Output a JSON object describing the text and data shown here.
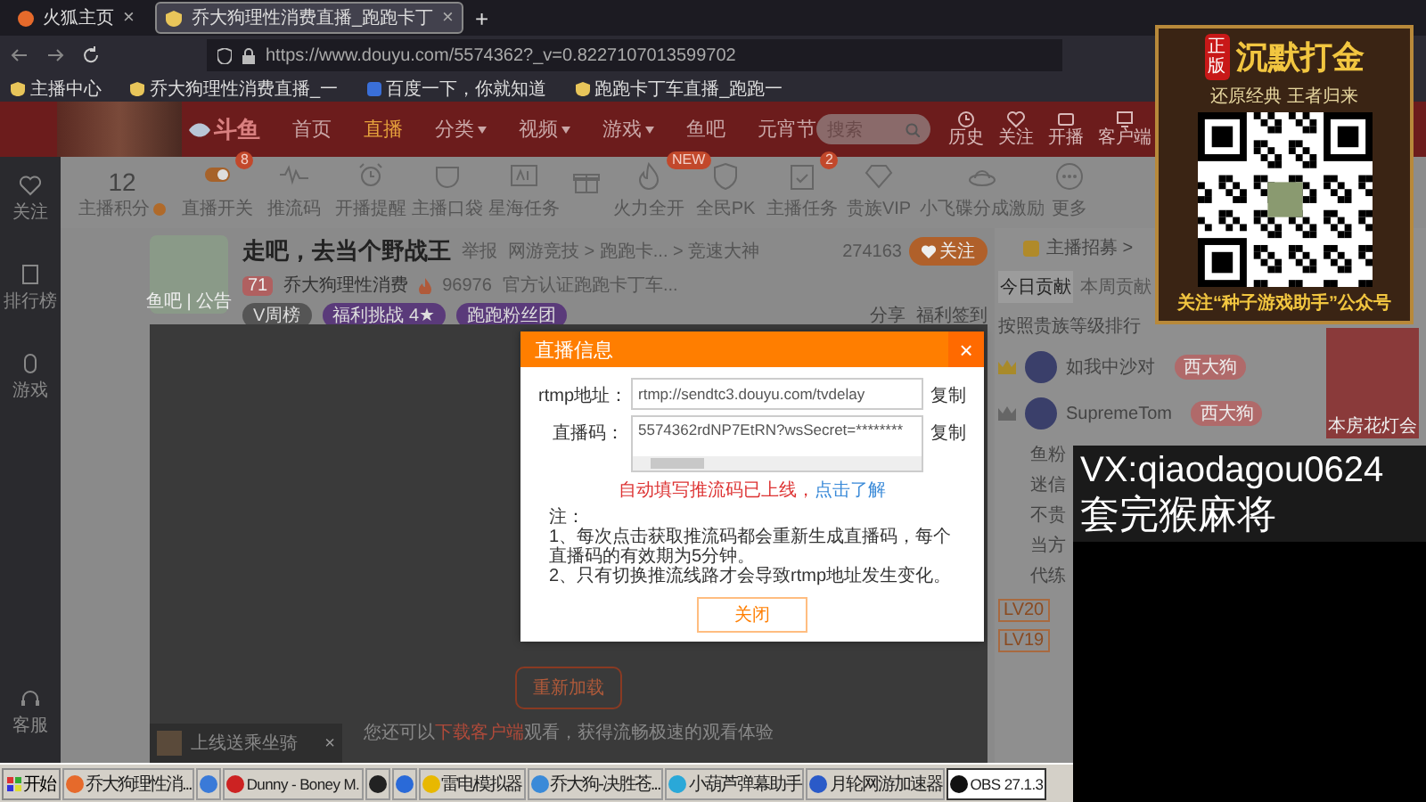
{
  "browser": {
    "tabs": [
      {
        "title": "火狐主页",
        "close": "×",
        "selected": false
      },
      {
        "title": "乔大狗理性消费直播_跑跑卡丁",
        "close": "×",
        "selected": true
      }
    ],
    "new_tab": "+",
    "url": "https://www.douyu.com/5574362?_v=0.8227107013599702",
    "bookmarks": [
      "主播中心",
      "乔大狗理性消费直播_一",
      "百度一下，你就知道",
      "跑跑卡丁车直播_跑跑一"
    ]
  },
  "site_header": {
    "logo": "斗鱼",
    "nav": [
      {
        "label": "首页",
        "selected": false,
        "dropdown": false
      },
      {
        "label": "直播",
        "selected": true,
        "dropdown": false
      },
      {
        "label": "分类",
        "selected": false,
        "dropdown": true
      },
      {
        "label": "视频",
        "selected": false,
        "dropdown": true
      },
      {
        "label": "游戏",
        "selected": false,
        "dropdown": true
      },
      {
        "label": "鱼吧",
        "selected": false,
        "dropdown": false
      },
      {
        "label": "元宵节",
        "selected": false,
        "dropdown": false
      }
    ],
    "search": {
      "placeholder": "搜索"
    },
    "actions": [
      "历史",
      "关注",
      "开播",
      "客户端"
    ]
  },
  "sidebar": [
    "关注",
    "排行榜",
    "游戏",
    "客服"
  ],
  "toolbar": {
    "score": {
      "value": "12",
      "label": "主播积分"
    },
    "items": [
      {
        "kind": "labeled",
        "label": "直播开关",
        "badge": "8"
      },
      {
        "kind": "labeled",
        "label": "推流码"
      },
      {
        "kind": "labeled",
        "label": "开播提醒"
      },
      {
        "kind": "labeled",
        "label": "主播口袋"
      },
      {
        "kind": "labeled",
        "label": "星海任务"
      },
      {
        "kind": "icon"
      },
      {
        "kind": "labeled",
        "label": "火力全开",
        "badge": "NEW"
      },
      {
        "kind": "labeled",
        "label": "全民PK"
      },
      {
        "kind": "labeled",
        "label": "主播任务",
        "badge": "2"
      },
      {
        "kind": "labeled",
        "label": "贵族VIP"
      },
      {
        "kind": "labeled",
        "label": "小飞碟分成激励"
      }
    ],
    "more": "更多"
  },
  "streamer": {
    "avatar_caption": "鱼吧 | 公告",
    "title": "走吧，去当个野战王",
    "report": "举报",
    "category": "网游竞技 > 跑跑卡... > 竞速大神",
    "level": "71",
    "name": "乔大狗理性消费",
    "heat": "96976",
    "certification": "官方认证跑跑卡丁车...",
    "followers": "274163",
    "follow": "关注",
    "tags": [
      "V周榜",
      "福利挑战 4★",
      "跑跑粉丝团"
    ],
    "share": "分享",
    "checkin": "福利签到"
  },
  "video": {
    "reload": "重新加载",
    "tip_before": "您还可以",
    "tip_link": "下载客户端",
    "tip_after": "观看，获得流畅极速的观看体验",
    "toast": "上线送乘坐骑",
    "toast_close": "×"
  },
  "right_panel": {
    "recruit": "主播招募 >",
    "tabs": [
      {
        "label": "今日贡献",
        "selected": true
      },
      {
        "label": "本周贡献",
        "selected": false
      }
    ],
    "ranking_title": "按照贵族等级排行",
    "ranking": [
      {
        "name": "如我中沙对",
        "badge": "西大狗"
      },
      {
        "name": "SupremeTom",
        "badge": "西大狗"
      }
    ],
    "notice_lines": [
      "鱼粉",
      "迷信",
      "不贵",
      "当方",
      "代练"
    ],
    "levels": [
      "LV20",
      "LV19"
    ],
    "event_banner": "本房花灯会"
  },
  "dialog": {
    "title": "直播信息",
    "close": "×",
    "fields": [
      {
        "label": "rtmp地址：",
        "value": "rtmp://sendtc3.douyu.com/tvdelay",
        "copy": "复制",
        "kind": "line"
      },
      {
        "label": "直播码：",
        "value": "5574362rdNP7EtRN?wsSecret=********",
        "copy": "复制",
        "kind": "area"
      }
    ],
    "warning": "自动填写推流码已上线，",
    "warning_link": "点击了解",
    "note_title": "注：",
    "notes": [
      "1、每次点击获取推流码都会重新生成直播码，每个直播码的有效期为5分钟。",
      "2、只有切换推流线路才会导致rtmp地址发生变化。"
    ],
    "button": "关闭"
  },
  "taskbar": {
    "start": "开始",
    "items": [
      {
        "label": "乔大狗理性消...",
        "selected": false
      },
      {
        "selected": false
      },
      {
        "label": "Dunny - Boney M.",
        "selected": false
      },
      {
        "selected": false
      },
      {
        "selected": false
      },
      {
        "label": "雷电模拟器",
        "selected": false
      },
      {
        "label": "乔大狗-决胜苍...",
        "selected": false
      },
      {
        "label": "小葫芦弹幕助手",
        "selected": false
      },
      {
        "label": "月轮网游加速器",
        "selected": false
      },
      {
        "label": "OBS 27.1.3",
        "selected": true
      }
    ]
  },
  "stream_overlay": {
    "ad": {
      "badge": "正版",
      "title": "沉默打金",
      "slogan": "还原经典 王者归来",
      "footer": "关注“种子游戏助手”公众号"
    },
    "caption": [
      "VX:qiaodagou0624",
      "套完猴麻将"
    ]
  }
}
